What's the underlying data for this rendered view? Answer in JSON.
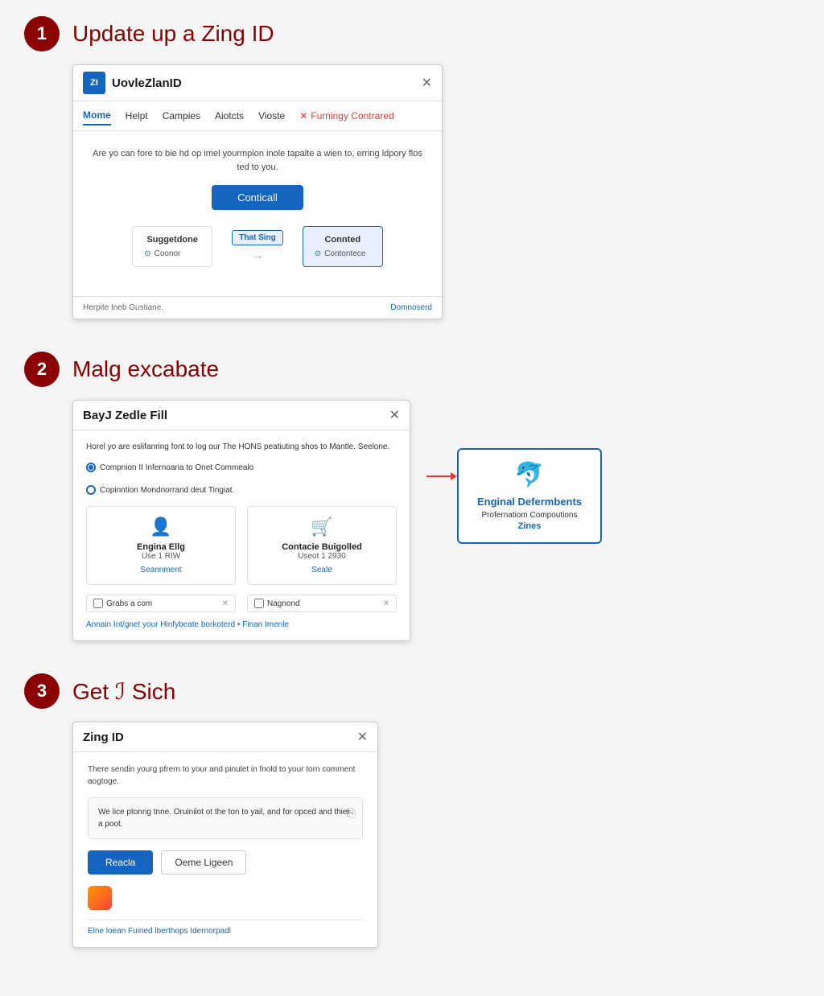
{
  "step1": {
    "number": "1",
    "title": "Update up a Zing ID",
    "window": {
      "app_name": "UovleZlanID",
      "logo_text": "ZI",
      "nav_items": [
        "Mome",
        "Helpt",
        "Campies",
        "Aiotcts",
        "Vioste"
      ],
      "nav_highlight": "Furningy Contrared",
      "body_desc": "Are yo can fore to bie hd op imel yourmpion inole tapalte a wien to, erring ldpory flos ted to you.",
      "cta_button": "Conticall",
      "options": [
        {
          "label": "Suggetdone",
          "items": [
            "Coonor"
          ]
        },
        {
          "label": "Connted",
          "items": [
            "Contontece"
          ]
        }
      ],
      "active_option": "That Sing",
      "footer_left": "Herpite Ineb Gustiane.",
      "footer_right": "Domnoserd"
    }
  },
  "step2": {
    "number": "2",
    "title": "Malg excabate",
    "window": {
      "title": "BayJ Zedle Fill",
      "desc": "Horel yo are eslifanring font to log our The HONS peatiuting shos to Mantle. Seelone.",
      "radio1": "Compnion II Infernoaria to Onet Commealo",
      "radio2": "Copinntion Mondnorrand deut Tingiat.",
      "card1": {
        "icon": "👤",
        "name": "Engina Ellg",
        "sub": "Use 1 RIW",
        "link": "Seannment"
      },
      "card2": {
        "icon": "🛒",
        "name": "Contacie Buigolled",
        "sub": "Useot 1 2930",
        "link": "Seale"
      },
      "footer1_left": "Grabs a com",
      "footer2_left": "Nagnond",
      "bottom_link": "Annain Int/gnet your Hinfybeate borkoterd • Finan Imenle"
    },
    "sidebar": {
      "icon": "🐬",
      "title": "Enginal Defermbents",
      "sub": "Profernatiom Compoutions",
      "zing": "Zines"
    }
  },
  "step3": {
    "number": "3",
    "title": "Get ℐ Sich",
    "window": {
      "title": "Zing ID",
      "desc": "There sendin yourg pfrern to your and pinulet in fnold to your torn comment aogtoge.",
      "message": "We lice ptonng tnne. Oruinilot ot the ton to yail, and for opced and thier a poot.",
      "btn_primary": "Reacla",
      "btn_secondary": "Oeme Ligeen",
      "footer_link": "Elne loean Fuined lberthops Idernorpadl"
    }
  }
}
